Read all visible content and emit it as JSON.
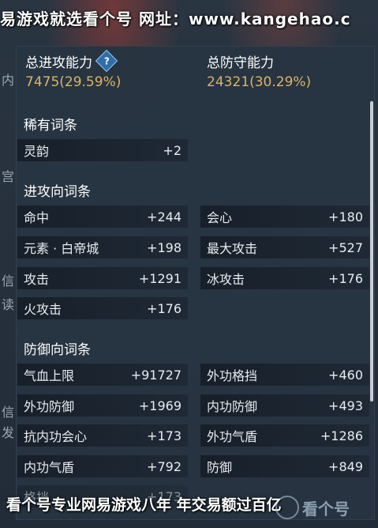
{
  "watermark_top": "易游戏就选看个号  网址：www.kangehao.c",
  "watermark_bottom": "看个号专业网易游戏八年  年交易额过百亿",
  "logo_text": "看个号",
  "left_strip": [
    "内",
    "宫",
    "信",
    "读",
    "信",
    "发"
  ],
  "summary": {
    "attack_title": "总进攻能力",
    "attack_value": "7475(29.59%)",
    "defense_title": "总防守能力",
    "defense_value": "24321(30.29%)"
  },
  "sections": {
    "rare_title": "稀有词条",
    "attack_title": "进攻向词条",
    "defense_title": "防御向词条"
  },
  "rare": [
    {
      "name": "灵韵",
      "value": "+2"
    }
  ],
  "attack": [
    {
      "name": "命中",
      "value": "+244"
    },
    {
      "name": "会心",
      "value": "+180"
    },
    {
      "name": "元素 · 白帝城",
      "value": "+198"
    },
    {
      "name": "最大攻击",
      "value": "+527"
    },
    {
      "name": "攻击",
      "value": "+1291"
    },
    {
      "name": "冰攻击",
      "value": "+176"
    },
    {
      "name": "火攻击",
      "value": "+176"
    }
  ],
  "defense": [
    {
      "name": "气血上限",
      "value": "+91727"
    },
    {
      "name": "外功格挡",
      "value": "+460"
    },
    {
      "name": "外功防御",
      "value": "+1969"
    },
    {
      "name": "内功防御",
      "value": "+493"
    },
    {
      "name": "抗内功会心",
      "value": "+173"
    },
    {
      "name": "外功气盾",
      "value": "+1286"
    },
    {
      "name": "内功气盾",
      "value": "+792"
    },
    {
      "name": "防御",
      "value": "+849"
    },
    {
      "name": "格挡",
      "value": "+173"
    }
  ]
}
